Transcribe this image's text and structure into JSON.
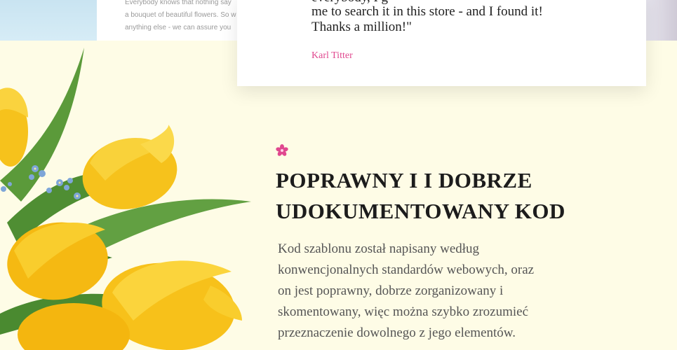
{
  "previous_section": {
    "text_lines": [
      "Everybody knows that nothing say",
      "a bouquet of beautiful flowers. So w",
      "anything else - we can assure you"
    ]
  },
  "testimonial": {
    "quote_clipped": "everybody, I g",
    "quote_lines": [
      "me to search it in this store - and I found it!",
      "Thanks a million!\""
    ],
    "author": "Karl Titter"
  },
  "feature": {
    "heading_lines": [
      "POPRAWNY I  I DOBRZE",
      "UDOKUMENTOWANY KOD"
    ],
    "paragraph_lines": [
      "Kod szablonu został napisany według",
      "konwencjonalnych standardów webowych, oraz",
      "on jest poprawny, dobrze zorganizowany i",
      "skomentowany, więc można szybko zrozumieć",
      "przeznaczenie dowolnego z jego elementów."
    ],
    "icon": "flower-icon",
    "accent_color": "#e0488f"
  },
  "colors": {
    "background": "#fefce6",
    "heading": "#1c1c1c",
    "body_text": "#555555",
    "accent": "#e0488f"
  }
}
